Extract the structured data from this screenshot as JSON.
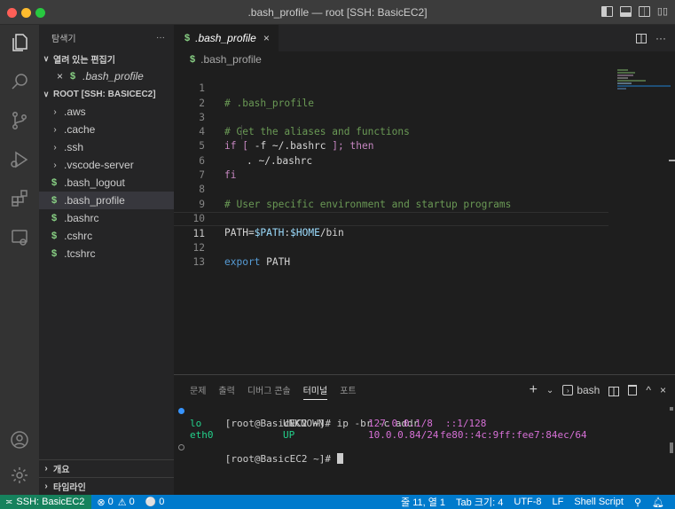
{
  "window": {
    "title": ".bash_profile — root [SSH: BasicEC2]"
  },
  "sidebar": {
    "title": "탐색기",
    "more": "···",
    "open_editors_label": "열려 있는 편집기",
    "open_editor_item": ".bash_profile",
    "root_label": "ROOT [SSH: BASICEC2]",
    "folders": [
      ".aws",
      ".cache",
      ".ssh",
      ".vscode-server"
    ],
    "files": [
      ".bash_logout",
      ".bash_profile",
      ".bashrc",
      ".cshrc",
      ".tcshrc"
    ],
    "outline_label": "개요",
    "timeline_label": "타임라인",
    "file_icon_glyph": "$"
  },
  "tab": {
    "label": ".bash_profile",
    "close": "×"
  },
  "tab_actions": {
    "more": "···"
  },
  "breadcrumb": {
    "label": ".bash_profile"
  },
  "editor": {
    "line_numbers": [
      "1",
      "2",
      "3",
      "4",
      "5",
      "6",
      "7",
      "8",
      "9",
      "10",
      "11",
      "12",
      "13"
    ],
    "current_line": 11,
    "lines": {
      "l1": "# .bash_profile",
      "l3": "# Get the aliases and functions",
      "l4_if": "if",
      "l4_open": " [ ",
      "l4_test": "-f ~/.bashrc",
      "l4_close": " ]; ",
      "l4_then": "then",
      "l5": ". ~/.bashrc",
      "l6": "fi",
      "l8": "# User specific environment and startup programs",
      "l10_name": "PATH=",
      "l10_v1": "$PATH",
      "l10_sep": ":",
      "l10_v2": "$HOME",
      "l10_tail": "/bin",
      "l12_kw": "export",
      "l12_name": " PATH"
    }
  },
  "panel": {
    "tabs": [
      "문제",
      "출력",
      "디버그 콘솔",
      "터미널",
      "포트"
    ],
    "active_tab": "터미널",
    "add": "+",
    "dropdown": "⌄",
    "shell": "bash",
    "maximize": "^",
    "close": "×"
  },
  "terminal": {
    "prompt1": "[root@BasicEC2 ~]# ip -br -c addr",
    "row1": {
      "iface": "lo",
      "state": "UNKNOWN",
      "addr_v4": "127.0.0.1/8",
      "addr_v6": "::1/128"
    },
    "row2": {
      "iface": "eth0",
      "state": "UP",
      "addr_v4": "10.0.0.84/24",
      "addr_v6": "fe80::4c:9ff:fee7:84ec/64"
    },
    "prompt2": "[root@BasicEC2 ~]# "
  },
  "status": {
    "remote": "SSH: BasicEC2",
    "errors": "0",
    "warnings": "0",
    "ports": "0",
    "position": "줄 11, 열 1",
    "tab_size": "Tab 크기: 4",
    "encoding": "UTF-8",
    "eol": "LF",
    "language": "Shell Script"
  },
  "colors": {
    "accent": "#007acc",
    "remote": "#16825d",
    "comment": "#6a9955",
    "keyword": "#c586c0",
    "variable": "#9cdcfe",
    "file_icon": "#89d185"
  }
}
